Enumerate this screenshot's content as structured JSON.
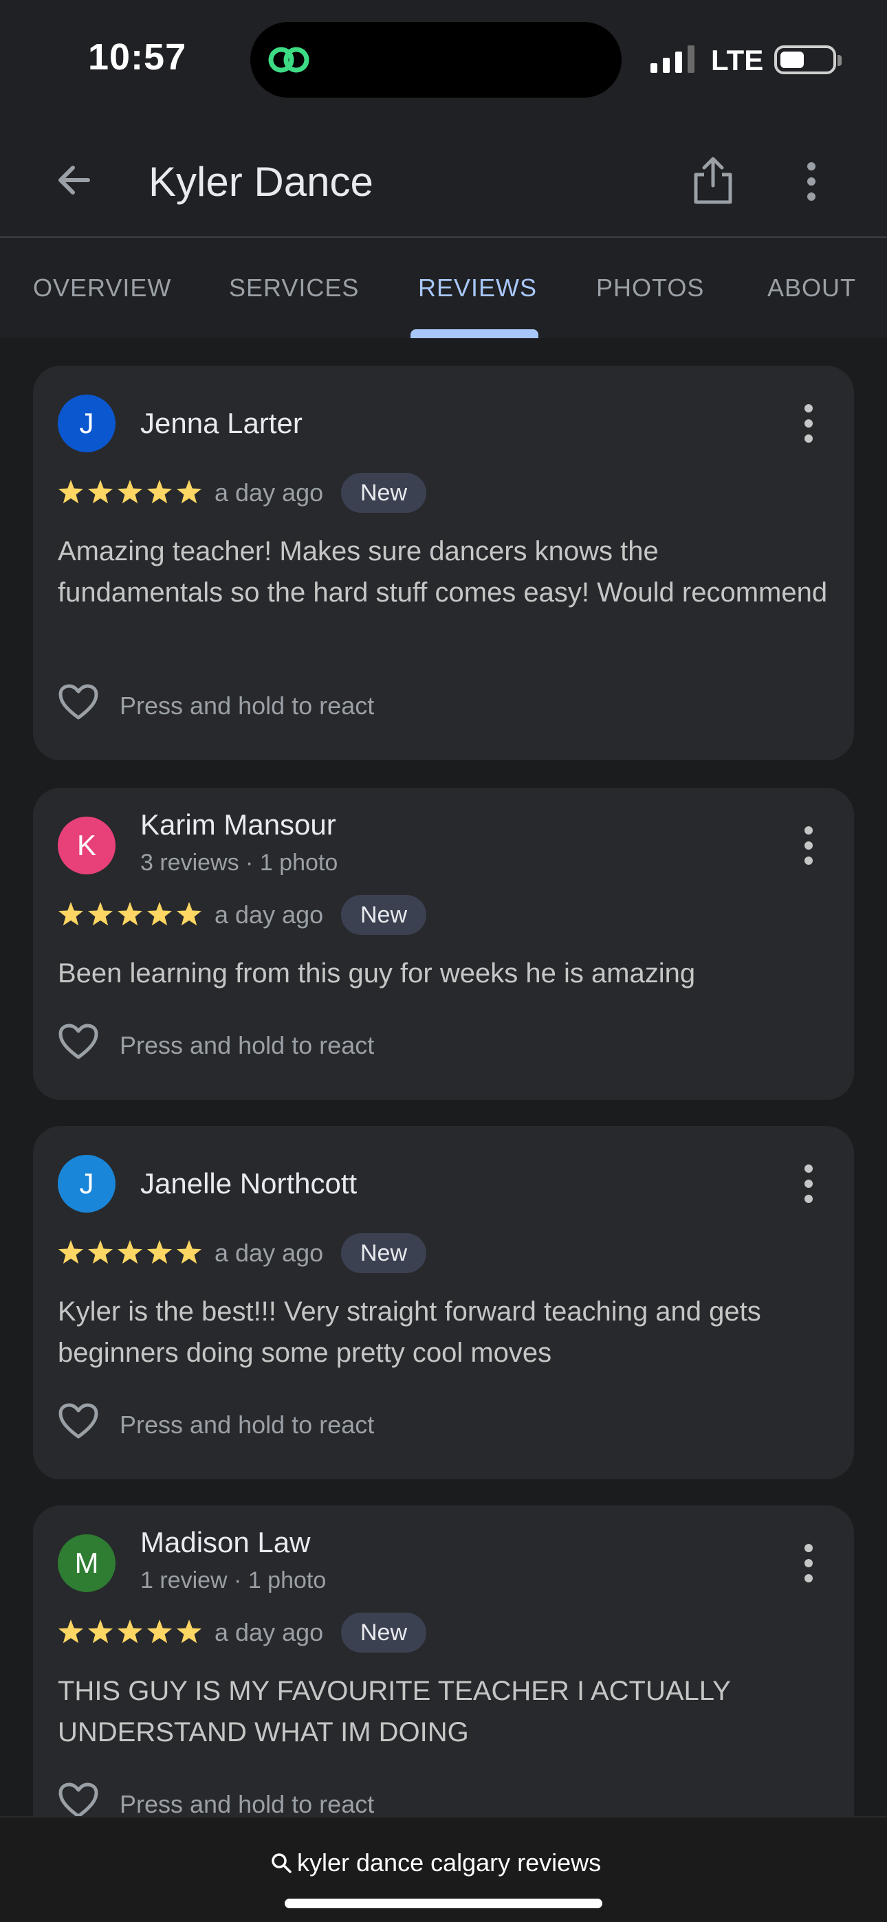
{
  "status": {
    "time": "10:57",
    "network": "LTE"
  },
  "header": {
    "title": "Kyler Dance"
  },
  "tabs": [
    {
      "label": "OVERVIEW"
    },
    {
      "label": "SERVICES"
    },
    {
      "label": "REVIEWS"
    },
    {
      "label": "PHOTOS"
    },
    {
      "label": "ABOUT"
    }
  ],
  "active_tab": "REVIEWS",
  "reviews": [
    {
      "initial": "J",
      "avatar_color": "#0b57d0",
      "name": "Jenna Larter",
      "meta": "",
      "rating": 5,
      "time": "a day ago",
      "badge": "New",
      "text": "Amazing teacher! Makes sure dancers knows the fundamentals so the hard stuff comes easy! Would recommend",
      "react": "Press and hold to react"
    },
    {
      "initial": "K",
      "avatar_color": "#e8417a",
      "name": "Karim Mansour",
      "meta": "3 reviews · 1 photo",
      "rating": 5,
      "time": "a day ago",
      "badge": "New",
      "text": "Been learning from this guy for weeks he is amazing",
      "react": "Press and hold to react"
    },
    {
      "initial": "J",
      "avatar_color": "#1a86d9",
      "name": "Janelle Northcott",
      "meta": "",
      "rating": 5,
      "time": "a day ago",
      "badge": "New",
      "text": "Kyler is the best!!! Very straight forward teaching and gets beginners doing some pretty cool moves",
      "react": "Press and hold to react"
    },
    {
      "initial": "M",
      "avatar_color": "#2e7d32",
      "name": "Madison Law",
      "meta": "1 review · 1 photo",
      "rating": 5,
      "time": "a day ago",
      "badge": "New",
      "text": "THIS GUY IS MY FAVOURITE TEACHER I ACTUALLY UNDERSTAND WHAT IM DOING",
      "react": "Press and hold to react"
    }
  ],
  "bottom_search": {
    "query": "kyler dance calgary reviews"
  },
  "colors": {
    "accent": "#a8c7fa",
    "star": "#fdd663",
    "background": "#202124",
    "card": "#28292c"
  }
}
